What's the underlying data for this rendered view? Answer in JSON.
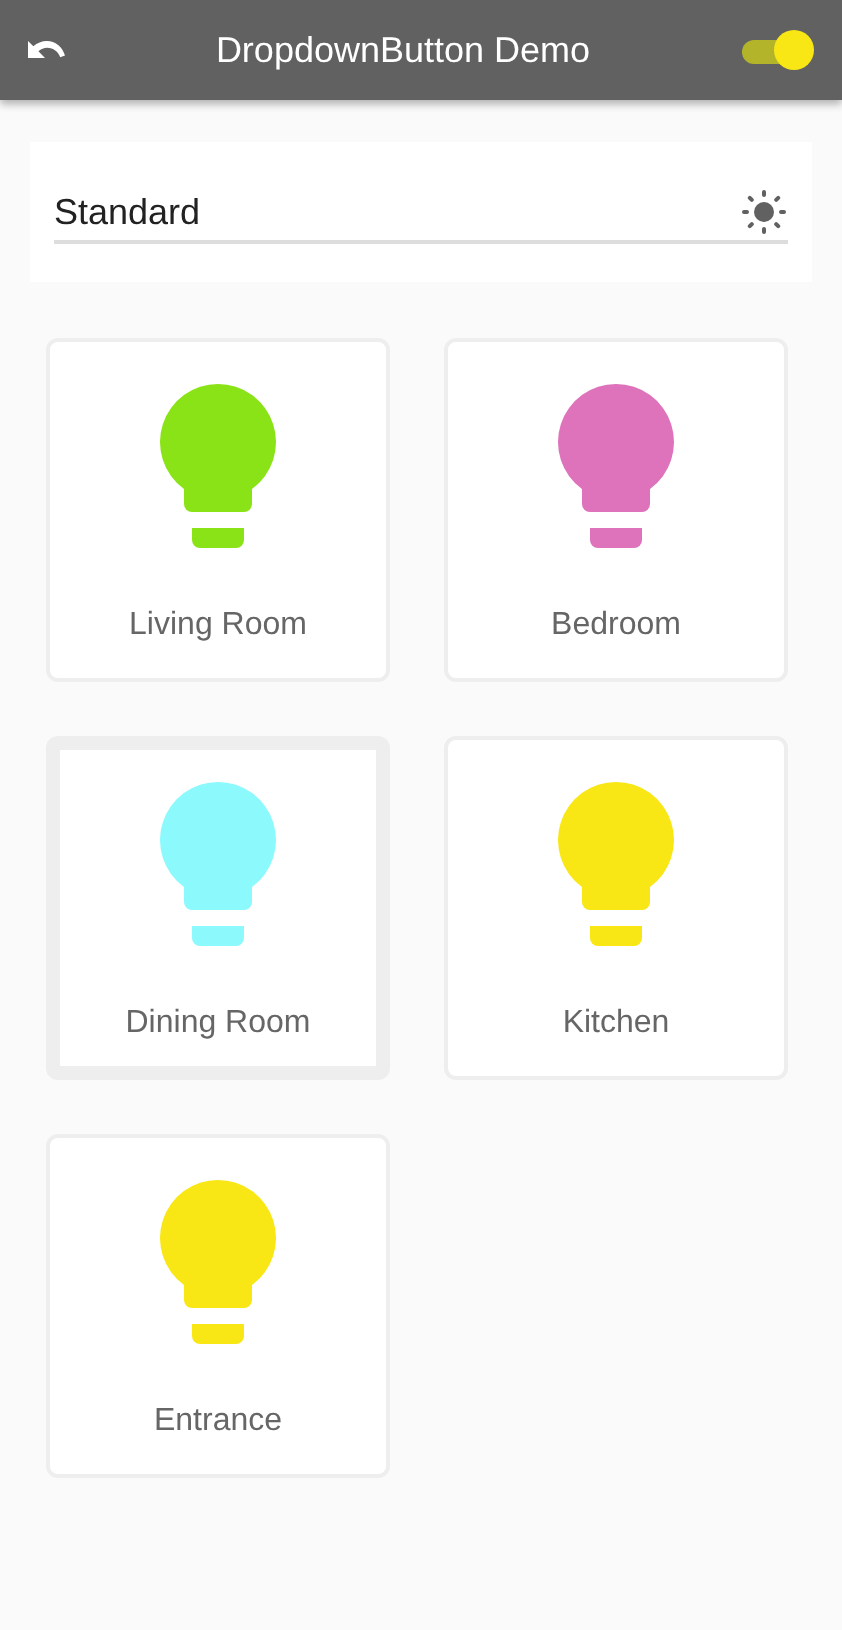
{
  "app_bar": {
    "title": "DropdownButton Demo",
    "toggle": {
      "on": true
    }
  },
  "dropdown": {
    "value": "Standard"
  },
  "rooms": [
    {
      "label": "Living Room",
      "color": "#8ae317",
      "selected": false
    },
    {
      "label": "Bedroom",
      "color": "#de72bb",
      "selected": false
    },
    {
      "label": "Dining Room",
      "color": "#8cf9fc",
      "selected": true
    },
    {
      "label": "Kitchen",
      "color": "#f8e714",
      "selected": false
    },
    {
      "label": "Entrance",
      "color": "#f8e714",
      "selected": false
    }
  ]
}
